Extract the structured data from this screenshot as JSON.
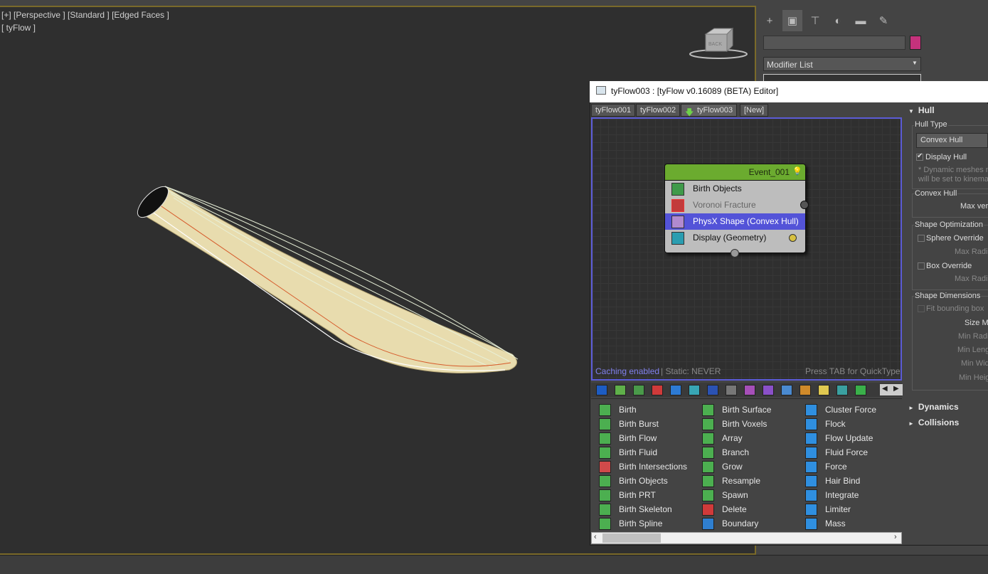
{
  "viewport": {
    "label1": "[+] [Perspective ] [Standard ] [Edged Faces ]",
    "label2": "[ tyFlow ]",
    "viewcube_face": "BACK"
  },
  "command_panel": {
    "tabs": [
      "create-icon",
      "modify-icon",
      "hierarchy-icon",
      "motion-icon",
      "display-icon",
      "utilities-icon"
    ],
    "modifier_list": "Modifier List",
    "object_color": "#c5327c"
  },
  "editor": {
    "title": "tyFlow003 : [tyFlow v0.16089 (BETA) Editor]",
    "tabs": [
      "tyFlow001",
      "tyFlow002",
      "tyFlow003",
      "[New]"
    ],
    "event": {
      "name": "Event_001",
      "operators": [
        "Birth Objects",
        "Voronoi Fracture",
        "PhysX Shape (Convex Hull)",
        "Display (Geometry)"
      ]
    },
    "status": {
      "cache": "Caching enabled",
      "static": "| Static: NEVER",
      "hint": "Press TAB for QuickType"
    },
    "palette": {
      "col1": [
        "Birth",
        "Birth Burst",
        "Birth Flow",
        "Birth Fluid",
        "Birth Intersections",
        "Birth Objects",
        "Birth PRT",
        "Birth Skeleton",
        "Birth Spline"
      ],
      "col2": [
        "Birth Surface",
        "Birth Voxels",
        "Array",
        "Branch",
        "Grow",
        "Resample",
        "Spawn",
        "Delete",
        "Boundary"
      ],
      "col3": [
        "Cluster Force",
        "Flock",
        "Flow Update",
        "Fluid Force",
        "Force",
        "Hair Bind",
        "Integrate",
        "Limiter",
        "Mass"
      ]
    }
  },
  "rollout": {
    "hull": "Hull",
    "hull_type": "Hull Type",
    "hull_type_value": "Convex Hull",
    "display_hull": "Display Hull",
    "note1": "* Dynamic meshes no",
    "note2": "will be set to kinemat",
    "convex_hull": "Convex Hull",
    "max_verts": "Max ver",
    "shape_opt": "Shape Optimization",
    "sphere_override": "Sphere Override",
    "max_radius1": "Max Radi",
    "box_override": "Box Override",
    "max_radius2": "Max Radi",
    "shape_dim": "Shape Dimensions",
    "fit_bbox": "Fit bounding box",
    "size_mult": "Size Mu",
    "min_radius": "Min Radi",
    "min_length": "Min Leng",
    "min_width": "Min Wid",
    "min_height": "Min Heig",
    "dynamics": "Dynamics",
    "collisions": "Collisions"
  }
}
